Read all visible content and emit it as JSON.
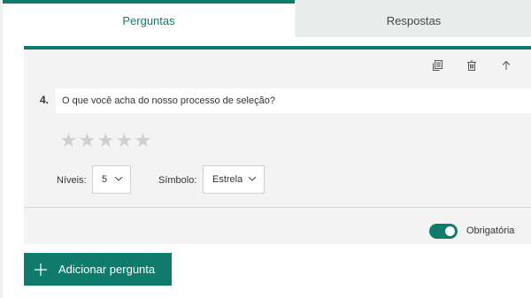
{
  "tabs": [
    {
      "label": "Perguntas",
      "active": true
    },
    {
      "label": "Respostas",
      "active": false
    }
  ],
  "toolbar": {
    "icons": [
      "copy-question-icon",
      "delete-icon",
      "move-up-icon"
    ]
  },
  "question": {
    "number": "4.",
    "text": "O que você acha do nosso processo de seleção?",
    "stars": [
      "★",
      "★",
      "★",
      "★",
      "★"
    ],
    "levels_label": "Níveis:",
    "levels_value": "5",
    "symbol_label": "Símbolo:",
    "symbol_value": "Estrela",
    "required_label": "Obrigatória",
    "required_on": true
  },
  "add_button": {
    "label": "Adicionar pergunta"
  },
  "colors": {
    "accent": "#0f7b6c",
    "star_empty": "#cfcfcf"
  }
}
